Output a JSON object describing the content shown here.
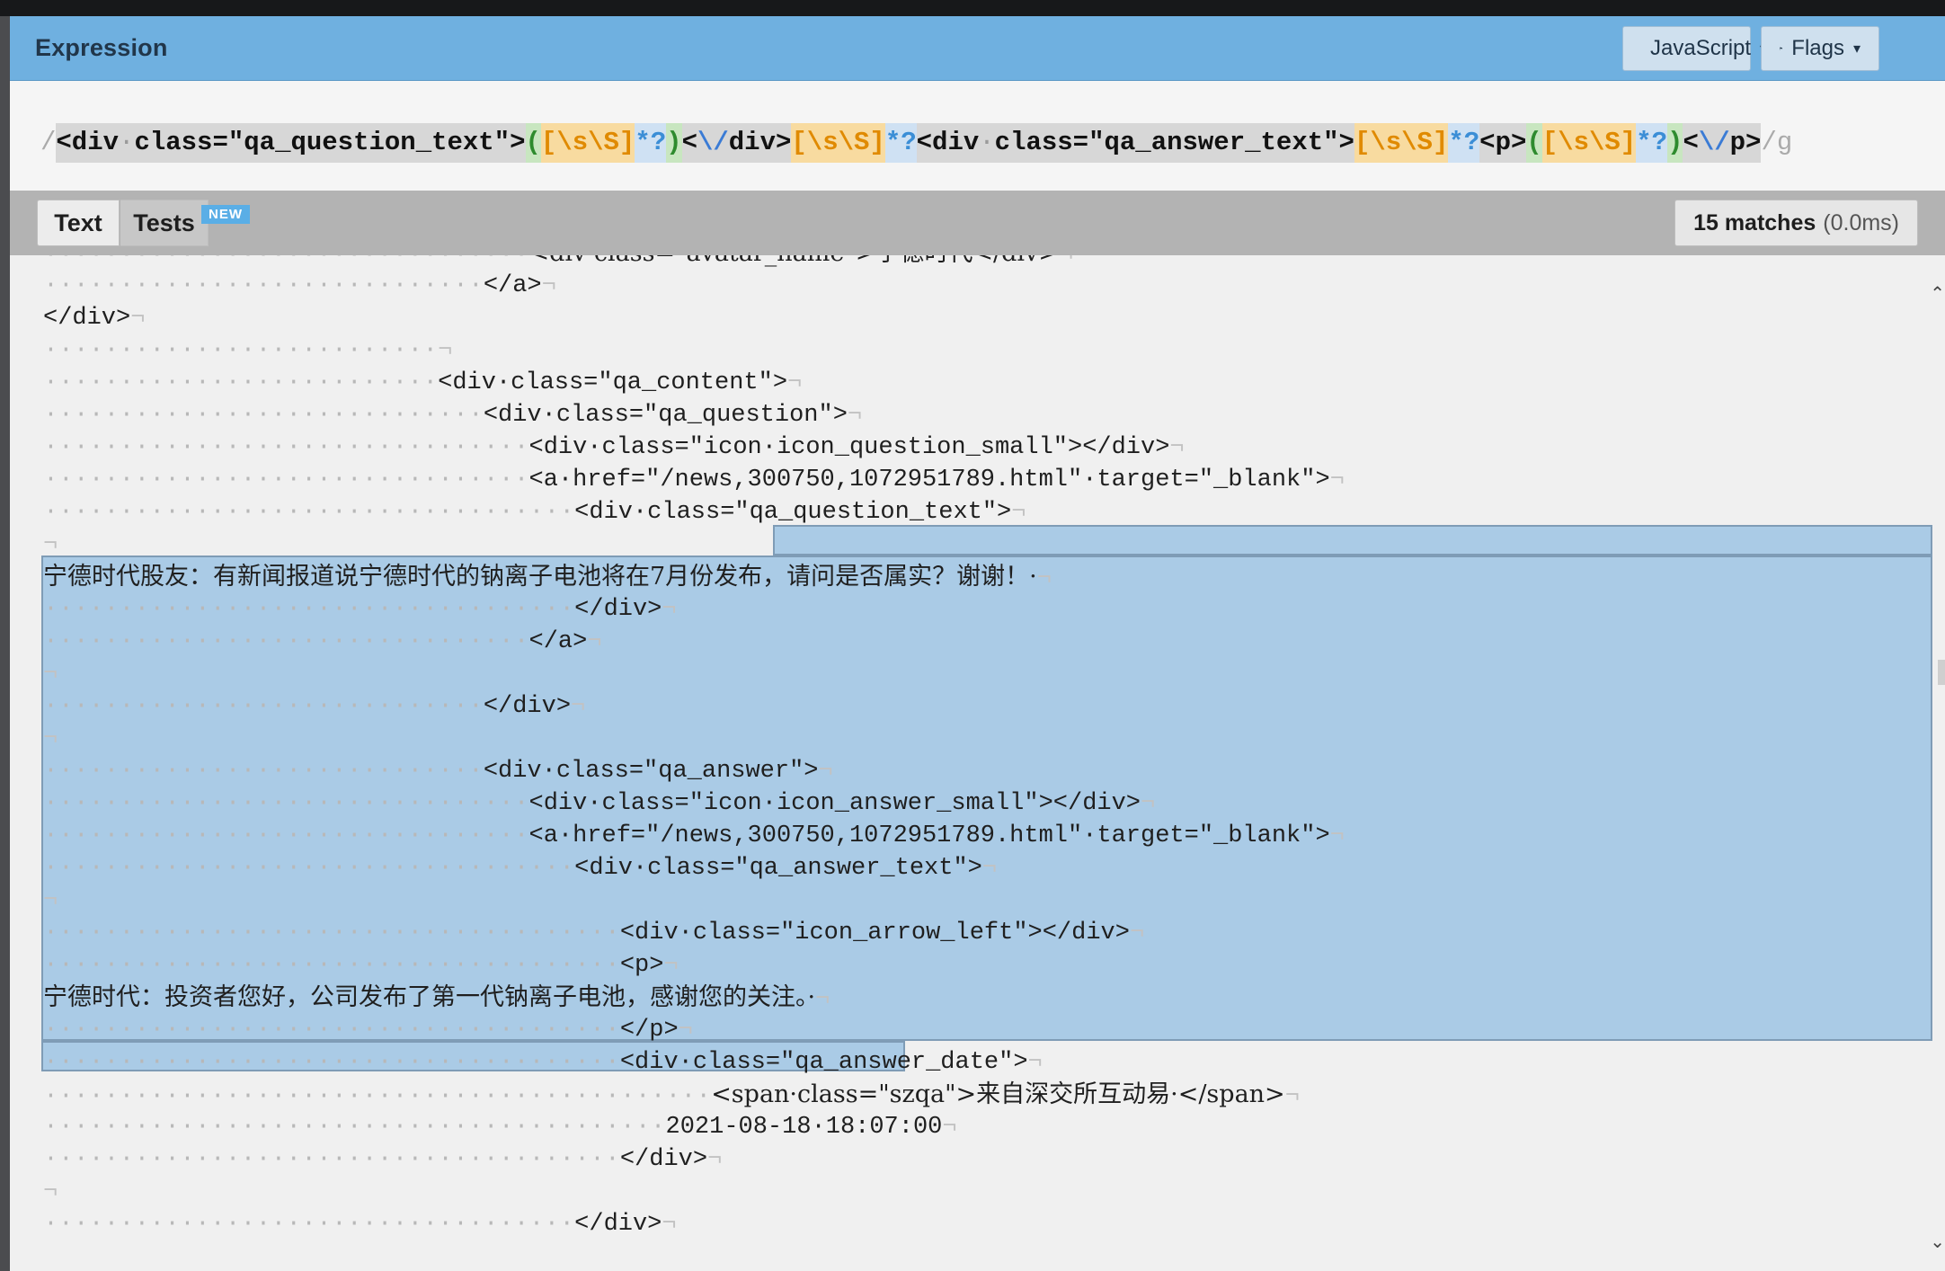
{
  "header": {
    "title": "Expression",
    "flavor_label": "JavaScript",
    "flags_label": "Flags"
  },
  "regex": {
    "tokens": [
      {
        "t": "/",
        "k": "delim"
      },
      {
        "t": "<div",
        "k": "lit"
      },
      {
        "t": "·",
        "k": "litdot"
      },
      {
        "t": "class=\"qa_question_text\">",
        "k": "lit"
      },
      {
        "t": "(",
        "k": "grp"
      },
      {
        "t": "[\\s\\S]",
        "k": "set"
      },
      {
        "t": "*?",
        "k": "q"
      },
      {
        "t": ")",
        "k": "grp"
      },
      {
        "t": "<",
        "k": "lit"
      },
      {
        "t": "\\/",
        "k": "esc"
      },
      {
        "t": "div>",
        "k": "lit"
      },
      {
        "t": "[\\s\\S]",
        "k": "set"
      },
      {
        "t": "*?",
        "k": "q"
      },
      {
        "t": "<div",
        "k": "lit"
      },
      {
        "t": "·",
        "k": "litdot"
      },
      {
        "t": "class=\"qa_answer_text\">",
        "k": "lit"
      },
      {
        "t": "[\\s\\S]",
        "k": "set"
      },
      {
        "t": "*?",
        "k": "q"
      },
      {
        "t": "<p>",
        "k": "lit"
      },
      {
        "t": "(",
        "k": "grp"
      },
      {
        "t": "[\\s\\S]",
        "k": "set"
      },
      {
        "t": "*?",
        "k": "q"
      },
      {
        "t": ")",
        "k": "grp"
      },
      {
        "t": "<",
        "k": "lit"
      },
      {
        "t": "\\/",
        "k": "esc"
      },
      {
        "t": "p>",
        "k": "lit"
      },
      {
        "t": "/g",
        "k": "flag"
      }
    ]
  },
  "tabs": {
    "text_label": "Text",
    "tests_label": "Tests",
    "tests_badge": "NEW",
    "match_count": "15 matches",
    "match_time": "(0.0ms)"
  },
  "editor": {
    "lines": [
      {
        "indent": 32,
        "text": "<div·class=\"avatar_name\">宁德时代</div>"
      },
      {
        "indent": 29,
        "text": "</a>"
      },
      {
        "indent": 0,
        "text": "</div>"
      },
      {
        "indent": 26,
        "text": ""
      },
      {
        "indent": 26,
        "text": "<div·class=\"qa_content\">"
      },
      {
        "indent": 29,
        "text": "<div·class=\"qa_question\">"
      },
      {
        "indent": 32,
        "text": "<div·class=\"icon·icon_question_small\"></div>"
      },
      {
        "indent": 32,
        "text": "<a·href=\"/news,300750,1072951789.html\"·target=\"_blank\">"
      },
      {
        "indent": 35,
        "text": "<div·class=\"qa_question_text\">"
      },
      {
        "indent": 0,
        "text": ""
      },
      {
        "indent": 0,
        "text": "宁德时代股友：有新闻报道说宁德时代的钠离子电池将在7月份发布，请问是否属实？谢谢！·"
      },
      {
        "indent": 35,
        "text": "</div>"
      },
      {
        "indent": 32,
        "text": "</a>"
      },
      {
        "indent": 0,
        "text": ""
      },
      {
        "indent": 29,
        "text": "</div>"
      },
      {
        "indent": 0,
        "text": ""
      },
      {
        "indent": 29,
        "text": "<div·class=\"qa_answer\">"
      },
      {
        "indent": 32,
        "text": "<div·class=\"icon·icon_answer_small\"></div>"
      },
      {
        "indent": 32,
        "text": "<a·href=\"/news,300750,1072951789.html\"·target=\"_blank\">"
      },
      {
        "indent": 35,
        "text": "<div·class=\"qa_answer_text\">"
      },
      {
        "indent": 0,
        "text": ""
      },
      {
        "indent": 38,
        "text": "<div·class=\"icon_arrow_left\"></div>"
      },
      {
        "indent": 38,
        "text": "<p>"
      },
      {
        "indent": 0,
        "text": "宁德时代：投资者您好，公司发布了第一代钠离子电池，感谢您的关注。·"
      },
      {
        "indent": 38,
        "text": "</p>"
      },
      {
        "indent": 38,
        "text": "<div·class=\"qa_answer_date\">"
      },
      {
        "indent": 44,
        "text": "<span·class=\"szqa\">来自深交所互动易·</span>"
      },
      {
        "indent": 41,
        "text": "2021-08-18·18:07:00"
      },
      {
        "indent": 38,
        "text": "</div>"
      },
      {
        "indent": 0,
        "text": ""
      },
      {
        "indent": 35,
        "text": "</div>"
      }
    ]
  }
}
